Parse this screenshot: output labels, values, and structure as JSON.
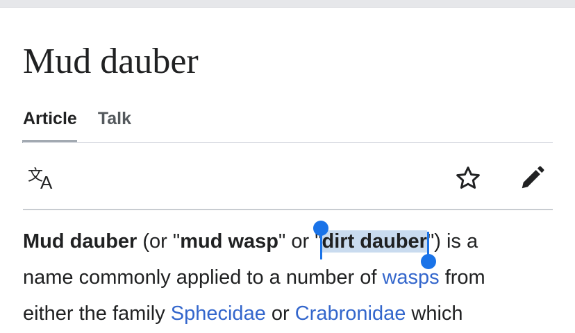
{
  "page": {
    "title": "Mud dauber"
  },
  "tabs": [
    {
      "label": "Article",
      "active": true
    },
    {
      "label": "Talk",
      "active": false
    }
  ],
  "toolbar": {
    "language_icon": "translate-icon",
    "watch_icon": "star-icon",
    "edit_icon": "pencil-icon"
  },
  "article": {
    "line1": {
      "bold1": "Mud dauber",
      "text1": " (or \"",
      "bold2": "mud wasp",
      "text2": "\" or \"",
      "selected_bold": "dirt dauber",
      "text3": "\") is a"
    },
    "line2": {
      "text1": "name commonly applied to a number of ",
      "link1": "wasps",
      "text2": " from"
    },
    "line3": {
      "text1": "either the family ",
      "link1": "Sphecidae",
      "text2": " or ",
      "link2": "Crabronidae",
      "text3": " which"
    }
  },
  "colors": {
    "link": "#3366cc",
    "selection_handle": "#1a73e8",
    "selection_highlight": "#c9dbef",
    "text": "#202122"
  }
}
